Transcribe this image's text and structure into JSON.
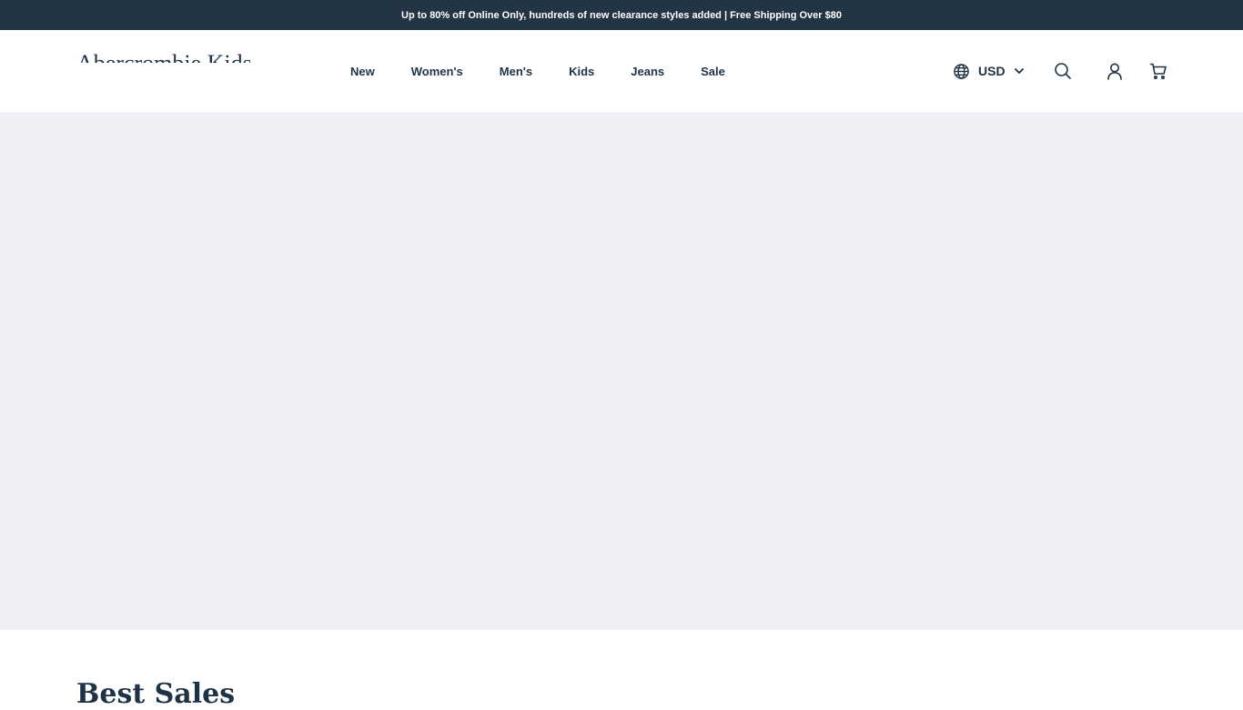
{
  "announcement": {
    "text": "Up to 80% off Online Only, hundreds of new clearance styles added | Free Shipping Over $80"
  },
  "header": {
    "logo_text": "Abercrombie Kids",
    "nav": [
      {
        "label": "New"
      },
      {
        "label": "Women's"
      },
      {
        "label": "Men's"
      },
      {
        "label": "Kids"
      },
      {
        "label": "Jeans"
      },
      {
        "label": "Sale"
      }
    ],
    "currency": {
      "selected": "USD",
      "icon": "globe-icon",
      "dropdown_icon": "chevron-down-icon"
    },
    "actions": {
      "search_icon": "search-icon",
      "account_icon": "user-icon",
      "cart_icon": "cart-icon"
    }
  },
  "sections": {
    "best_sales_title": "Best Sales"
  },
  "colors": {
    "announcement_bg": "#233445",
    "text_primary": "#1f3347",
    "hero_bg": "#eeeff4"
  }
}
